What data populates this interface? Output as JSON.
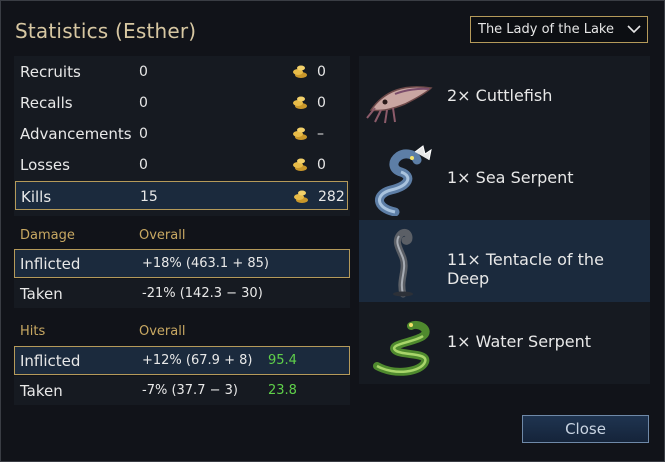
{
  "window": {
    "title": "Statistics (Esther)"
  },
  "scenario_dropdown": {
    "selected": "The Lady of the Lake"
  },
  "stats": [
    {
      "label": "Recruits",
      "value": "0",
      "cost": "0"
    },
    {
      "label": "Recalls",
      "value": "0",
      "cost": "0"
    },
    {
      "label": "Advancements",
      "value": "0",
      "cost": "–"
    },
    {
      "label": "Losses",
      "value": "0",
      "cost": "0"
    },
    {
      "label": "Kills",
      "value": "15",
      "cost": "282"
    }
  ],
  "damage": {
    "header": "Damage",
    "column": "Overall",
    "inflicted": {
      "label": "Inflicted",
      "value": "+18% (463.1 + 85)"
    },
    "taken": {
      "label": "Taken",
      "value": "-21% (142.3 − 30)"
    }
  },
  "hits": {
    "header": "Hits",
    "column": "Overall",
    "inflicted": {
      "label": "Inflicted",
      "value": "+12% (67.9 + 8)",
      "extra": "95.4"
    },
    "taken": {
      "label": "Taken",
      "value": "-7% (37.7 − 3)",
      "extra": "23.8"
    }
  },
  "kills_list": [
    {
      "label": "2× Cuttlefish",
      "icon": "cuttlefish-icon"
    },
    {
      "label": "1× Sea Serpent",
      "icon": "sea-serpent-icon"
    },
    {
      "label": "11× Tentacle of the Deep",
      "icon": "tentacle-icon"
    },
    {
      "label": "1× Water Serpent",
      "icon": "water-serpent-icon"
    }
  ],
  "buttons": {
    "close": "Close"
  },
  "colors": {
    "accent_gold": "#b59a5a",
    "positive_green": "#5fd04a",
    "header_gold": "#c8a862"
  }
}
